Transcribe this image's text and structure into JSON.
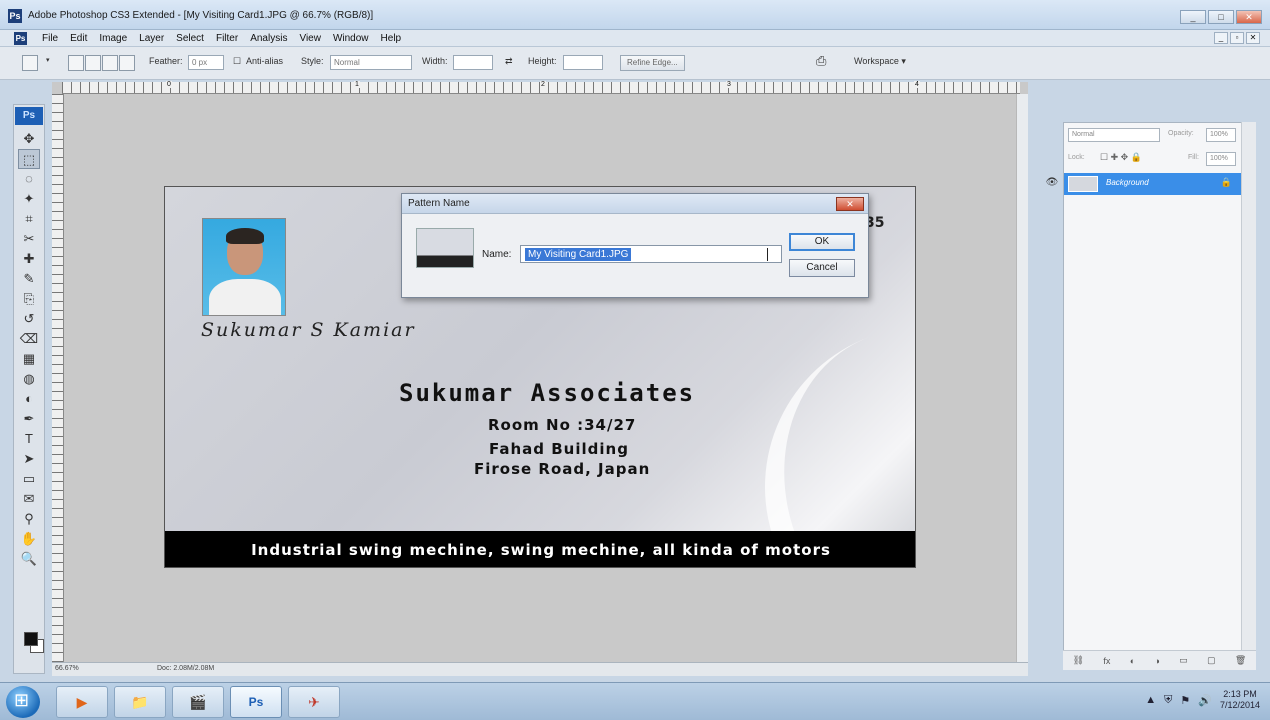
{
  "window": {
    "title": "Adobe Photoshop CS3 Extended - [My Visiting Card1.JPG @ 66.7% (RGB/8)]",
    "app_icon": "Ps",
    "controls": [
      "_",
      "□",
      "✕"
    ]
  },
  "menu": {
    "logo": "Ps",
    "items": [
      "File",
      "Edit",
      "Image",
      "Layer",
      "Select",
      "Filter",
      "Analysis",
      "View",
      "Window",
      "Help"
    ],
    "doc_controls": [
      "_",
      "▫",
      "✕"
    ]
  },
  "options": {
    "feather_label": "Feather:",
    "feather_value": "0 px",
    "antialias_label": "Anti-alias",
    "style_label": "Style:",
    "style_value": "Normal",
    "width_label": "Width:",
    "height_label": "Height:",
    "refine_edge": "Refine Edge...",
    "workspace_label": "Workspace ▾"
  },
  "toolbox": {
    "logo": "Ps",
    "tools": [
      "move-icon",
      "marquee-icon",
      "lasso-icon",
      "magic-wand-icon",
      "crop-icon",
      "slice-icon",
      "healing-icon",
      "brush-icon",
      "clone-stamp-icon",
      "history-brush-icon",
      "eraser-icon",
      "gradient-icon",
      "blur-icon",
      "dodge-icon",
      "pen-icon",
      "type-icon",
      "path-select-icon",
      "shape-icon",
      "notes-icon",
      "eyedropper-icon",
      "hand-icon",
      "zoom-icon"
    ],
    "tool_glyphs": [
      "✥",
      "⬚",
      "◌",
      "✦",
      "⌗",
      "✂",
      "✚",
      "✎",
      "⎘",
      "↺",
      "⌫",
      "▦",
      "◍",
      "◐",
      "✒",
      "T",
      "➤",
      "▭",
      "✉",
      "⚲",
      "✋",
      "🔍"
    ]
  },
  "ruler": {
    "numbers": [
      "0",
      "1",
      "2",
      "3",
      "4"
    ]
  },
  "card": {
    "signature": "Sukumar S Kamiar",
    "company": "Sukumar Associates",
    "room": "Room No :34/27",
    "building": "Fahad Building",
    "road": "Firose Road, Japan",
    "corner_text": "35",
    "banner": "Industrial swing mechine, swing mechine, all kinda of motors"
  },
  "dialog": {
    "title": "Pattern Name",
    "close": "✕",
    "name_label": "Name:",
    "name_value": "My Visiting Card1.JPG",
    "ok_label": "OK",
    "cancel_label": "Cancel"
  },
  "layers": {
    "blend_mode": "Normal",
    "opacity_label": "Opacity:",
    "opacity_value": "100%",
    "lock_label": "Lock:",
    "fill_label": "Fill:",
    "fill_value": "100%",
    "layer_name": "Background",
    "bottom_icons": [
      "⛓",
      "fx",
      "◐",
      "◑",
      "▭",
      "▢",
      "🗑"
    ]
  },
  "status": {
    "zoom": "66.67%",
    "doc": "Doc: 2.08M/2.08M"
  },
  "taskbar": {
    "items": [
      "▶",
      "📁",
      "🎬",
      "Ps",
      "✈"
    ],
    "time": "2:13 PM",
    "date": "7/12/2014",
    "tray_icons": [
      "▲",
      "⛨",
      "⚑",
      "🔊"
    ]
  }
}
